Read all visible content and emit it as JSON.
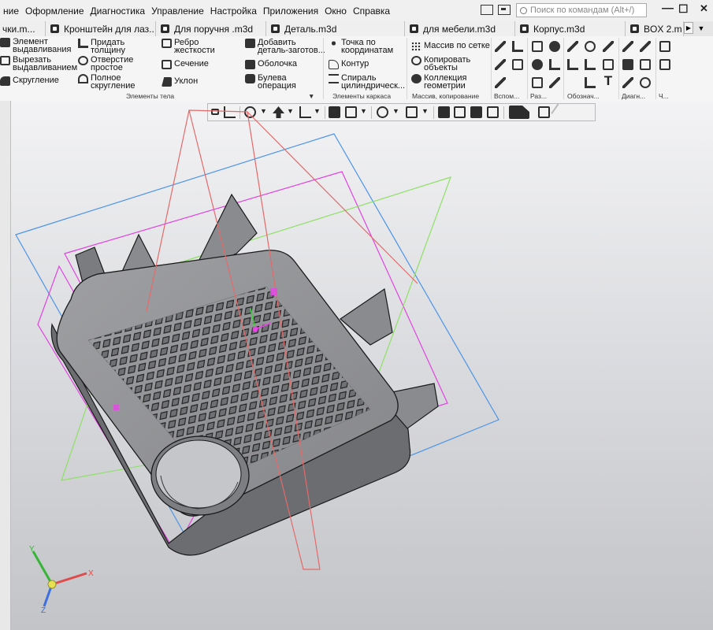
{
  "menu": {
    "items": [
      "ние",
      "Оформление",
      "Диагностика",
      "Управление",
      "Настройка",
      "Приложения",
      "Окно",
      "Справка"
    ],
    "search_placeholder": "Поиск по командам (Alt+/)",
    "minimize": "—",
    "maximize": "☐",
    "close": "✕"
  },
  "tabs": [
    "чки.m...",
    "Кронштейн для лаз...",
    "Для поручня .m3d",
    "Деталь.m3d",
    "для мебели.m3d",
    "Корпус.m3d",
    "BOX 2.m"
  ],
  "ribbon": {
    "body": {
      "extrude": "Элемент\nвыдавливания",
      "cut_extrude": "Вырезать\nвыдавливанием",
      "fillet": "Скругление",
      "shell_thickness": "Придать\nтолщину",
      "hole": "Отверстие\nпростое",
      "full_fillet": "Полное\nскругление",
      "rib": "Ребро\nжесткости",
      "section": "Сечение",
      "draft": "Уклон",
      "add_stock": "Добавить\nдеталь-заготов...",
      "shell": "Оболочка",
      "boolean": "Булева\nоперация",
      "group_label": "Элементы тела"
    },
    "wireframe": {
      "point_coords": "Точка по\nкоординатам",
      "contour": "Контур",
      "helix": "Спираль\nцилиндрическ...",
      "group_label": "Элементы каркаса"
    },
    "array": {
      "grid_array": "Массив по сетке",
      "copy_objects": "Копировать\nобъекты",
      "geometry_collection": "Коллекция\nгеометрии",
      "group_label": "Массив, копирование"
    },
    "groups_small": [
      "Вспом...",
      "Раз...",
      "Обознач...",
      "Диагн...",
      "Ч..."
    ]
  },
  "triad": {
    "x": "X",
    "y": "Y",
    "z": "Z"
  },
  "colors": {
    "plane_blue": "#3d8fe6",
    "plane_magenta": "#e040e0",
    "plane_green": "#8fe060",
    "plane_red": "#e06060",
    "model_gray": "#8a8a8a"
  }
}
